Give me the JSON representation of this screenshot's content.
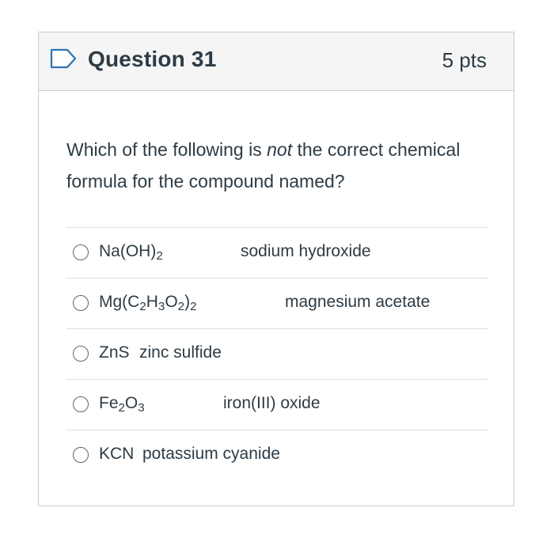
{
  "question": {
    "title": "Question 31",
    "points": "5 pts",
    "text_pre": "Which of the following is ",
    "text_em": "not",
    "text_post": " the correct chemical formula for the compound named?"
  },
  "answers": [
    {
      "formula_parts": [
        "Na(OH)",
        "2"
      ],
      "name": "sodium hydroxide"
    },
    {
      "formula_parts": [
        "Mg(C",
        "2",
        "H",
        "3",
        "O",
        "2",
        ")",
        "2"
      ],
      "name": "magnesium acetate"
    },
    {
      "formula_parts": [
        "ZnS"
      ],
      "name": "zinc sulfide"
    },
    {
      "formula_parts": [
        "Fe",
        "2",
        "O",
        "3"
      ],
      "name": "iron(III) oxide"
    },
    {
      "formula_parts": [
        "KCN"
      ],
      "name": "potassium cyanide"
    }
  ],
  "colors": {
    "header_bg": "#f5f5f5",
    "border": "#c7cdd1",
    "text": "#2d3b45",
    "divider": "#dadfe3"
  },
  "icons": {
    "flag": "bookmark-flag-icon",
    "radio": "radio-button-icon"
  }
}
